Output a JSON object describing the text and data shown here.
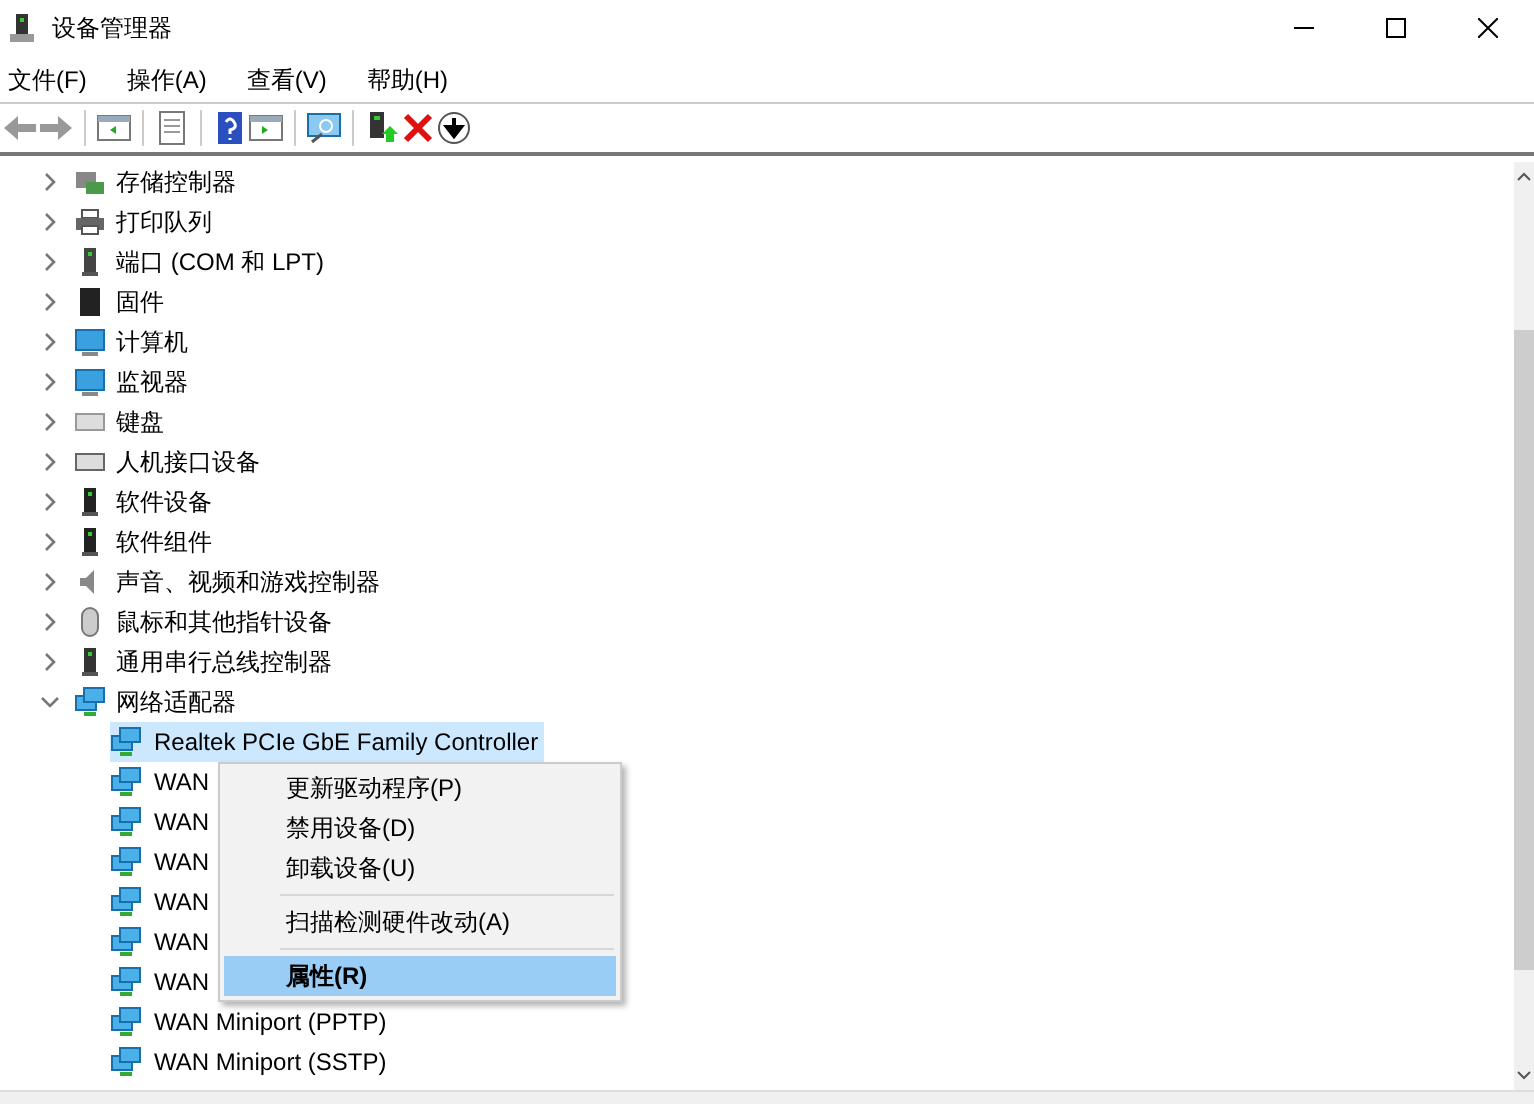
{
  "window": {
    "title": "设备管理器"
  },
  "menu_bar": [
    "文件(F)",
    "操作(A)",
    "查看(V)",
    "帮助(H)"
  ],
  "tree": [
    {
      "label": "存储控制器",
      "expanded": false
    },
    {
      "label": "打印队列",
      "expanded": false
    },
    {
      "label": "端口 (COM 和 LPT)",
      "expanded": false
    },
    {
      "label": "固件",
      "expanded": false
    },
    {
      "label": "计算机",
      "expanded": false
    },
    {
      "label": "监视器",
      "expanded": false
    },
    {
      "label": "键盘",
      "expanded": false
    },
    {
      "label": "人机接口设备",
      "expanded": false
    },
    {
      "label": "软件设备",
      "expanded": false
    },
    {
      "label": "软件组件",
      "expanded": false
    },
    {
      "label": "声音、视频和游戏控制器",
      "expanded": false
    },
    {
      "label": "鼠标和其他指针设备",
      "expanded": false
    },
    {
      "label": "通用串行总线控制器",
      "expanded": false
    },
    {
      "label": "网络适配器",
      "expanded": true,
      "children": [
        {
          "label": "Realtek PCIe GbE Family Controller",
          "selected": true
        },
        {
          "label": "WAN",
          "selected": false
        },
        {
          "label": "WAN",
          "selected": false
        },
        {
          "label": "WAN",
          "selected": false
        },
        {
          "label": "WAN",
          "selected": false
        },
        {
          "label": "WAN",
          "selected": false
        },
        {
          "label": "WAN",
          "selected": false
        },
        {
          "label": "WAN Miniport (PPTP)",
          "selected": false
        },
        {
          "label": "WAN Miniport (SSTP)",
          "selected": false
        }
      ]
    }
  ],
  "context_menu": [
    {
      "kind": "item",
      "label": "更新驱动程序(P)",
      "selected": false,
      "bold": false
    },
    {
      "kind": "item",
      "label": "禁用设备(D)",
      "selected": false,
      "bold": false
    },
    {
      "kind": "item",
      "label": "卸载设备(U)",
      "selected": false,
      "bold": false
    },
    {
      "kind": "separator"
    },
    {
      "kind": "item",
      "label": "扫描检测硬件改动(A)",
      "selected": false,
      "bold": false
    },
    {
      "kind": "separator"
    },
    {
      "kind": "item",
      "label": "属性(R)",
      "selected": true,
      "bold": true
    }
  ]
}
